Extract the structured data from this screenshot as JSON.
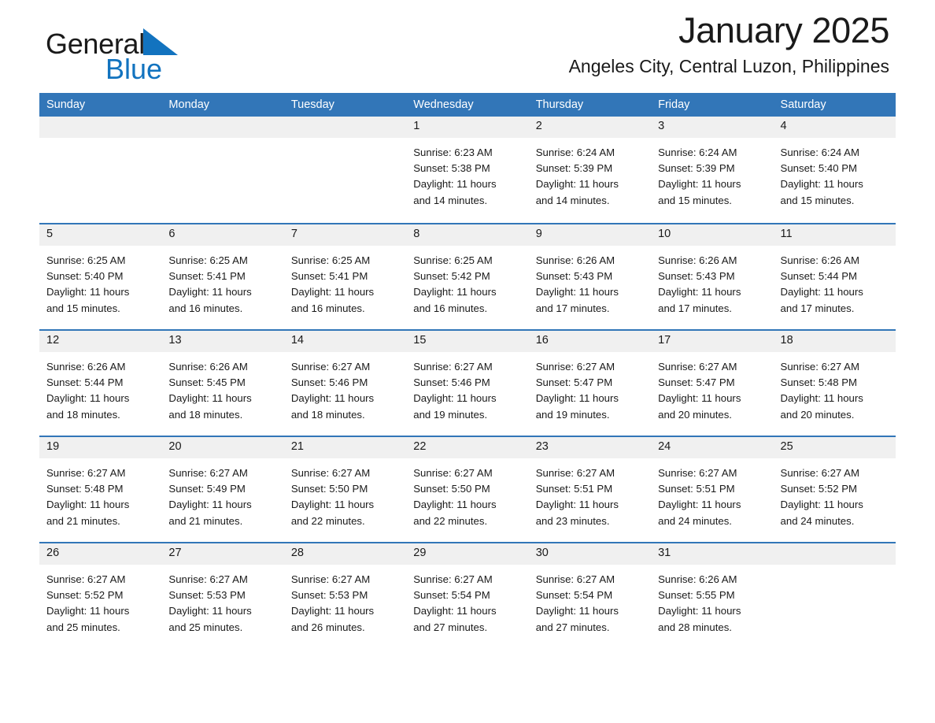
{
  "brand": {
    "name_part1": "General",
    "name_part2": "Blue",
    "triangle_color": "#1273bf",
    "logo_icon": "general-blue-triangle-logo"
  },
  "header": {
    "month_title": "January 2025",
    "location": "Angeles City, Central Luzon, Philippines"
  },
  "theme": {
    "header_blue": "#3276b8",
    "datenum_gray": "#f0f0f0",
    "brand_blue": "#1273bf",
    "text_black": "#1a1a1a"
  },
  "calendar": {
    "weekdays": [
      "Sunday",
      "Monday",
      "Tuesday",
      "Wednesday",
      "Thursday",
      "Friday",
      "Saturday"
    ],
    "weeks": [
      [
        {
          "day": "",
          "info": ""
        },
        {
          "day": "",
          "info": ""
        },
        {
          "day": "",
          "info": ""
        },
        {
          "day": "1",
          "info": "Sunrise: 6:23 AM\nSunset: 5:38 PM\nDaylight: 11 hours\nand 14 minutes."
        },
        {
          "day": "2",
          "info": "Sunrise: 6:24 AM\nSunset: 5:39 PM\nDaylight: 11 hours\nand 14 minutes."
        },
        {
          "day": "3",
          "info": "Sunrise: 6:24 AM\nSunset: 5:39 PM\nDaylight: 11 hours\nand 15 minutes."
        },
        {
          "day": "4",
          "info": "Sunrise: 6:24 AM\nSunset: 5:40 PM\nDaylight: 11 hours\nand 15 minutes."
        }
      ],
      [
        {
          "day": "5",
          "info": "Sunrise: 6:25 AM\nSunset: 5:40 PM\nDaylight: 11 hours\nand 15 minutes."
        },
        {
          "day": "6",
          "info": "Sunrise: 6:25 AM\nSunset: 5:41 PM\nDaylight: 11 hours\nand 16 minutes."
        },
        {
          "day": "7",
          "info": "Sunrise: 6:25 AM\nSunset: 5:41 PM\nDaylight: 11 hours\nand 16 minutes."
        },
        {
          "day": "8",
          "info": "Sunrise: 6:25 AM\nSunset: 5:42 PM\nDaylight: 11 hours\nand 16 minutes."
        },
        {
          "day": "9",
          "info": "Sunrise: 6:26 AM\nSunset: 5:43 PM\nDaylight: 11 hours\nand 17 minutes."
        },
        {
          "day": "10",
          "info": "Sunrise: 6:26 AM\nSunset: 5:43 PM\nDaylight: 11 hours\nand 17 minutes."
        },
        {
          "day": "11",
          "info": "Sunrise: 6:26 AM\nSunset: 5:44 PM\nDaylight: 11 hours\nand 17 minutes."
        }
      ],
      [
        {
          "day": "12",
          "info": "Sunrise: 6:26 AM\nSunset: 5:44 PM\nDaylight: 11 hours\nand 18 minutes."
        },
        {
          "day": "13",
          "info": "Sunrise: 6:26 AM\nSunset: 5:45 PM\nDaylight: 11 hours\nand 18 minutes."
        },
        {
          "day": "14",
          "info": "Sunrise: 6:27 AM\nSunset: 5:46 PM\nDaylight: 11 hours\nand 18 minutes."
        },
        {
          "day": "15",
          "info": "Sunrise: 6:27 AM\nSunset: 5:46 PM\nDaylight: 11 hours\nand 19 minutes."
        },
        {
          "day": "16",
          "info": "Sunrise: 6:27 AM\nSunset: 5:47 PM\nDaylight: 11 hours\nand 19 minutes."
        },
        {
          "day": "17",
          "info": "Sunrise: 6:27 AM\nSunset: 5:47 PM\nDaylight: 11 hours\nand 20 minutes."
        },
        {
          "day": "18",
          "info": "Sunrise: 6:27 AM\nSunset: 5:48 PM\nDaylight: 11 hours\nand 20 minutes."
        }
      ],
      [
        {
          "day": "19",
          "info": "Sunrise: 6:27 AM\nSunset: 5:48 PM\nDaylight: 11 hours\nand 21 minutes."
        },
        {
          "day": "20",
          "info": "Sunrise: 6:27 AM\nSunset: 5:49 PM\nDaylight: 11 hours\nand 21 minutes."
        },
        {
          "day": "21",
          "info": "Sunrise: 6:27 AM\nSunset: 5:50 PM\nDaylight: 11 hours\nand 22 minutes."
        },
        {
          "day": "22",
          "info": "Sunrise: 6:27 AM\nSunset: 5:50 PM\nDaylight: 11 hours\nand 22 minutes."
        },
        {
          "day": "23",
          "info": "Sunrise: 6:27 AM\nSunset: 5:51 PM\nDaylight: 11 hours\nand 23 minutes."
        },
        {
          "day": "24",
          "info": "Sunrise: 6:27 AM\nSunset: 5:51 PM\nDaylight: 11 hours\nand 24 minutes."
        },
        {
          "day": "25",
          "info": "Sunrise: 6:27 AM\nSunset: 5:52 PM\nDaylight: 11 hours\nand 24 minutes."
        }
      ],
      [
        {
          "day": "26",
          "info": "Sunrise: 6:27 AM\nSunset: 5:52 PM\nDaylight: 11 hours\nand 25 minutes."
        },
        {
          "day": "27",
          "info": "Sunrise: 6:27 AM\nSunset: 5:53 PM\nDaylight: 11 hours\nand 25 minutes."
        },
        {
          "day": "28",
          "info": "Sunrise: 6:27 AM\nSunset: 5:53 PM\nDaylight: 11 hours\nand 26 minutes."
        },
        {
          "day": "29",
          "info": "Sunrise: 6:27 AM\nSunset: 5:54 PM\nDaylight: 11 hours\nand 27 minutes."
        },
        {
          "day": "30",
          "info": "Sunrise: 6:27 AM\nSunset: 5:54 PM\nDaylight: 11 hours\nand 27 minutes."
        },
        {
          "day": "31",
          "info": "Sunrise: 6:26 AM\nSunset: 5:55 PM\nDaylight: 11 hours\nand 28 minutes."
        },
        {
          "day": "",
          "info": ""
        }
      ]
    ]
  }
}
